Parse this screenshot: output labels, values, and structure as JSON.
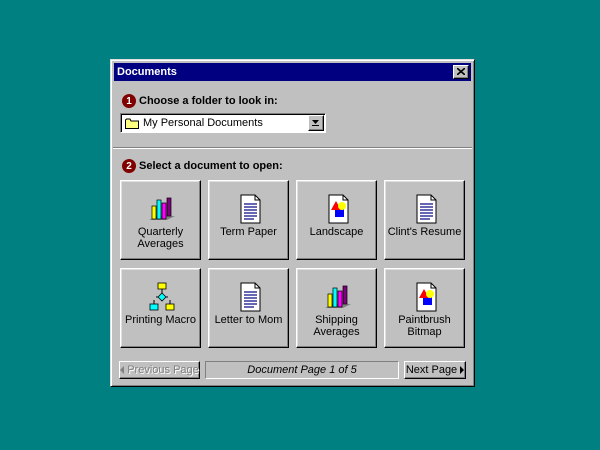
{
  "window": {
    "title": "Documents"
  },
  "step1": {
    "number": "1",
    "label": "Choose a folder to look in:"
  },
  "folder": {
    "selected": "My Personal Documents"
  },
  "step2": {
    "number": "2",
    "label": "Select a document to open:"
  },
  "documents": [
    {
      "label": "Quarterly\nAverages",
      "icon": "bar-chart-icon"
    },
    {
      "label": "Term Paper",
      "icon": "document-icon"
    },
    {
      "label": "Landscape",
      "icon": "picture-icon"
    },
    {
      "label": "Clint's Resume",
      "icon": "document-icon"
    },
    {
      "label": "Printing Macro",
      "icon": "flowchart-icon"
    },
    {
      "label": "Letter to Mom",
      "icon": "document-icon"
    },
    {
      "label": "Shipping\nAverages",
      "icon": "bar-chart-icon"
    },
    {
      "label": "Paintbrush\nBitmap",
      "icon": "picture-icon"
    }
  ],
  "pager": {
    "previous_label": "Previous Page",
    "status": "Document Page 1 of 5",
    "next_label": "Next Page"
  },
  "colors": {
    "desktop": "#008080",
    "titlebar": "#000080",
    "step_badge": "#800000",
    "window": "#c0c0c0"
  }
}
